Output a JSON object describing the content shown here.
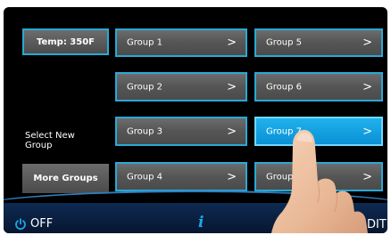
{
  "temp_button": {
    "label": "Temp: 350F"
  },
  "sidebar": {
    "select_new_group": "Select New\nGroup",
    "more_groups": "More Groups"
  },
  "groups": [
    {
      "label": "Group 1",
      "chevron": ">"
    },
    {
      "label": "Group 2",
      "chevron": ">"
    },
    {
      "label": "Group 3",
      "chevron": ">"
    },
    {
      "label": "Group 4",
      "chevron": ">"
    },
    {
      "label": "Group 5",
      "chevron": ">"
    },
    {
      "label": "Group 6",
      "chevron": ">"
    },
    {
      "label": "Group 7",
      "chevron": ">",
      "selected": true
    },
    {
      "label": "Group",
      "chevron": ">"
    }
  ],
  "footer": {
    "off_label": "OFF",
    "info_symbol": "i",
    "edit_label": "DIT"
  },
  "colors": {
    "accent": "#2aa9d6",
    "selected": "#0a90d6",
    "footer": "#0e2a52",
    "power_icon": "#1aa7e8"
  },
  "icons": [
    "power-icon",
    "info-icon",
    "chevron-right-icon"
  ]
}
